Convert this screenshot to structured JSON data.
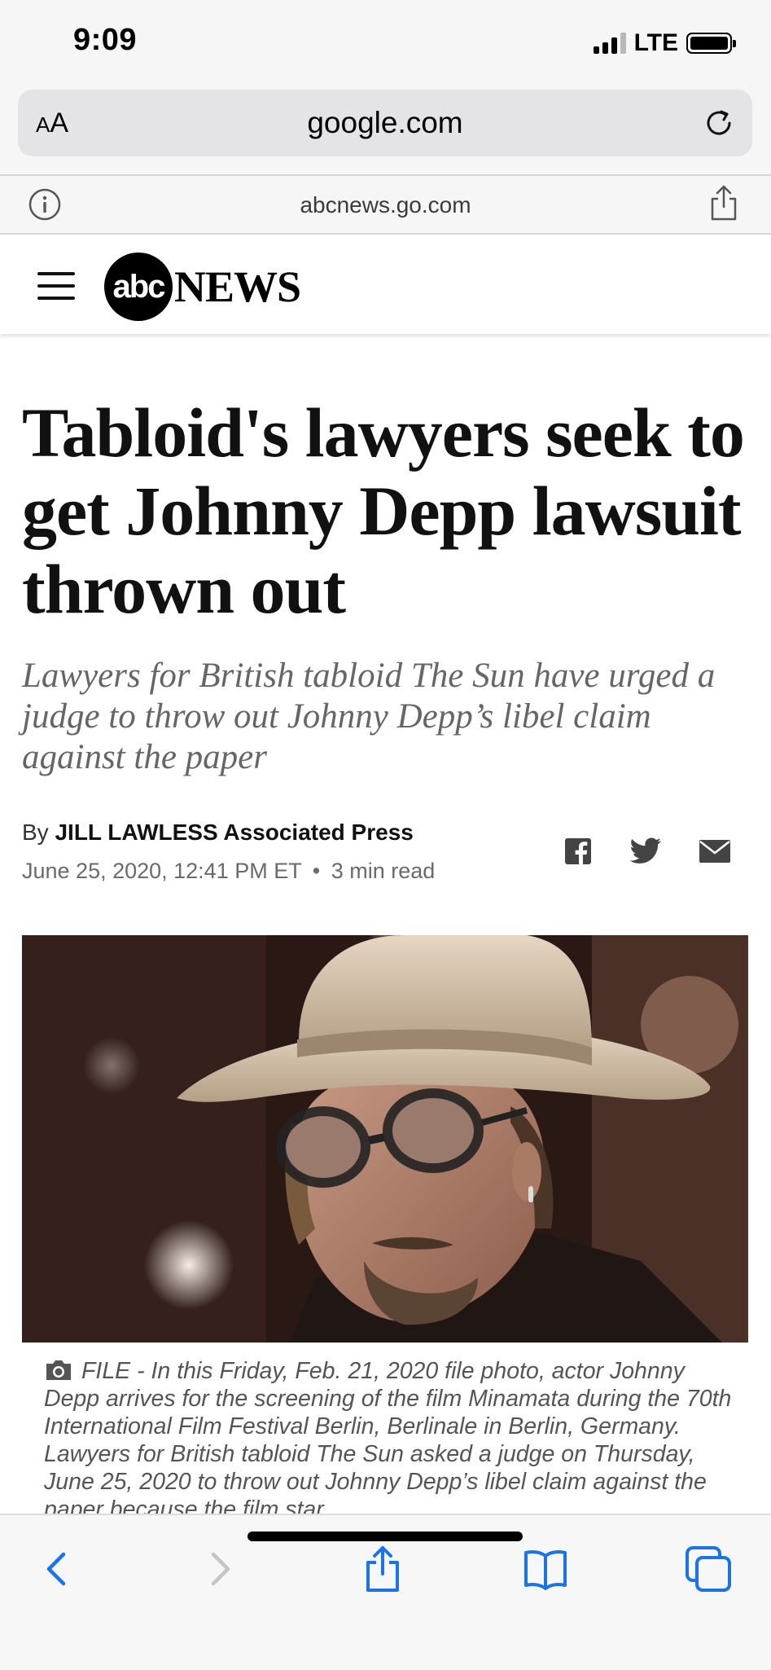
{
  "status_bar": {
    "time": "9:09",
    "network": "LTE",
    "signal_bars": 3,
    "signal_bars_total": 4,
    "battery_icon": "battery-full-icon"
  },
  "browser": {
    "text_size_small": "A",
    "text_size_big": "A",
    "url": "google.com",
    "site_host": "abcnews.go.com",
    "icons": {
      "reload": "reload-icon",
      "info": "info-icon",
      "share": "share-icon"
    }
  },
  "site": {
    "logo_abc": "abc",
    "logo_news": "NEWS"
  },
  "article": {
    "headline": "Tabloid's lawyers seek to get Johnny Depp lawsuit thrown out",
    "dek": "Lawyers for British tabloid The Sun have urged a judge to throw out Johnny Depp’s libel claim against the paper",
    "byline_prefix": "By",
    "author": "JILL LAWLESS Associated Press",
    "date": "June 25, 2020, 12:41 PM ET",
    "separator": "•",
    "read_time": "3 min read",
    "share_icons": [
      "facebook-icon",
      "twitter-icon",
      "email-icon"
    ],
    "photo_caption": "FILE - In this Friday, Feb. 21, 2020 file photo, actor Johnny Depp arrives for the screening of the film Minamata during the 70th International Film Festival Berlin, Berlinale in Berlin, Germany. Lawyers for British tabloid The Sun asked a judge on Thursday, June 25, 2020 to throw out Johnny Depp’s libel claim against the paper because the film star"
  },
  "toolbar": {
    "buttons": [
      "back-icon",
      "forward-icon",
      "share-icon",
      "bookmarks-icon",
      "tabs-icon"
    ],
    "accent_color": "#1a73e8",
    "disabled_color": "#c5c5c7"
  },
  "colors": {
    "page_bg": "#ffffff",
    "chrome_bg": "#f6f6f6",
    "urlbar_bg": "#e4e4e6",
    "headline": "#111111",
    "dek": "#666666",
    "caption": "#555555"
  }
}
